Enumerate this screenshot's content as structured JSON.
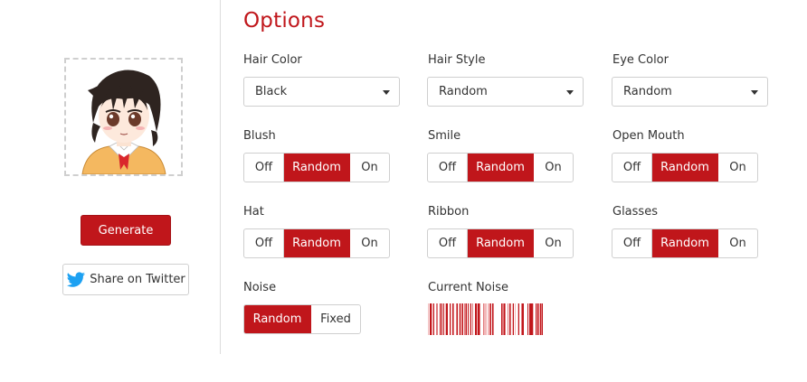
{
  "accent": "#c0161b",
  "left": {
    "generate_label": "Generate",
    "twitter_label": "Share on Twitter",
    "twitter_icon": "twitter-bird-icon"
  },
  "options": {
    "title": "Options",
    "hair_color": {
      "label": "Hair Color",
      "value": "Black"
    },
    "hair_style": {
      "label": "Hair Style",
      "value": "Random"
    },
    "eye_color": {
      "label": "Eye Color",
      "value": "Random"
    },
    "blush": {
      "label": "Blush",
      "off": "Off",
      "random": "Random",
      "on": "On",
      "selected": "Random"
    },
    "smile": {
      "label": "Smile",
      "off": "Off",
      "random": "Random",
      "on": "On",
      "selected": "Random"
    },
    "open_mouth": {
      "label": "Open Mouth",
      "off": "Off",
      "random": "Random",
      "on": "On",
      "selected": "Random"
    },
    "hat": {
      "label": "Hat",
      "off": "Off",
      "random": "Random",
      "on": "On",
      "selected": "Random"
    },
    "ribbon": {
      "label": "Ribbon",
      "off": "Off",
      "random": "Random",
      "on": "On",
      "selected": "Random"
    },
    "glasses": {
      "label": "Glasses",
      "off": "Off",
      "random": "Random",
      "on": "On",
      "selected": "Random"
    },
    "noise": {
      "label": "Noise",
      "random": "Random",
      "fixed": "Fixed",
      "selected": "Random"
    },
    "current_noise": {
      "label": "Current Noise"
    }
  }
}
